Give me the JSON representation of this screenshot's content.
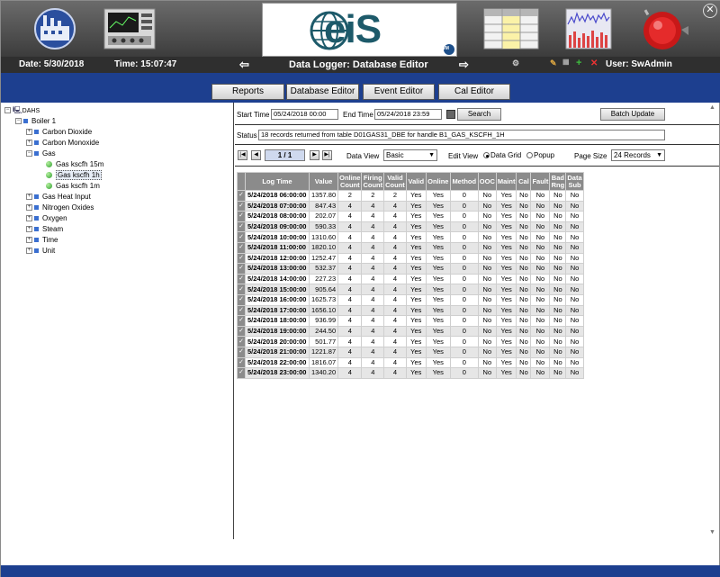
{
  "header": {
    "date_label": "Date: 5/30/2018",
    "time_label": "Time: 15:07:47",
    "title": "Data Logger: Database Editor",
    "user_label": "User: SwAdmin",
    "logo_text": "eiS",
    "logo_sub": "WM"
  },
  "nav": {
    "reports": "Reports",
    "database_editor": "Database Editor",
    "event_editor": "Event Editor",
    "cal_editor": "Cal Editor"
  },
  "tree": {
    "root": "DAHS",
    "boiler": "Boiler 1",
    "items": [
      "Carbon Dioxide",
      "Carbon Monoxide",
      "Gas",
      "Gas Heat Input",
      "Nitrogen Oxides",
      "Oxygen",
      "Steam",
      "Time",
      "Unit"
    ],
    "gas_children": [
      "Gas kscfh 15m",
      "Gas kscfh 1h",
      "Gas kscfh 1m"
    ]
  },
  "filters": {
    "start_time_label": "Start Time",
    "start_time_value": "05/24/2018 00:00",
    "end_time_label": "End Time",
    "end_time_value": "05/24/2018 23:59",
    "search_label": "Search",
    "batch_update_label": "Batch Update",
    "status_label": "Status",
    "status_value": "18 records returned from table D01GAS31_DBE for handle B1_GAS_KSCFH_1H"
  },
  "pager": {
    "page": "1 / 1",
    "data_view_label": "Data View",
    "data_view_value": "Basic",
    "edit_view_label": "Edit View",
    "edit_view_options": [
      "Data Grid",
      "Popup"
    ],
    "page_size_label": "Page Size",
    "page_size_value": "24 Records"
  },
  "grid": {
    "headers": [
      "Log Time",
      "Value",
      "Online Count",
      "Firing Count",
      "Valid Count",
      "Valid",
      "Online",
      "Method",
      "OOC",
      "Maint",
      "Cal",
      "Fault",
      "Bad Rng",
      "Data Sub"
    ],
    "rows": [
      [
        "5/24/2018 06:00:00",
        "1357.80",
        "2",
        "2",
        "2",
        "Yes",
        "Yes",
        "0",
        "No",
        "Yes",
        "No",
        "No",
        "No",
        "No"
      ],
      [
        "5/24/2018 07:00:00",
        "847.43",
        "4",
        "4",
        "4",
        "Yes",
        "Yes",
        "0",
        "No",
        "Yes",
        "No",
        "No",
        "No",
        "No"
      ],
      [
        "5/24/2018 08:00:00",
        "202.07",
        "4",
        "4",
        "4",
        "Yes",
        "Yes",
        "0",
        "No",
        "Yes",
        "No",
        "No",
        "No",
        "No"
      ],
      [
        "5/24/2018 09:00:00",
        "590.33",
        "4",
        "4",
        "4",
        "Yes",
        "Yes",
        "0",
        "No",
        "Yes",
        "No",
        "No",
        "No",
        "No"
      ],
      [
        "5/24/2018 10:00:00",
        "1310.60",
        "4",
        "4",
        "4",
        "Yes",
        "Yes",
        "0",
        "No",
        "Yes",
        "No",
        "No",
        "No",
        "No"
      ],
      [
        "5/24/2018 11:00:00",
        "1820.10",
        "4",
        "4",
        "4",
        "Yes",
        "Yes",
        "0",
        "No",
        "Yes",
        "No",
        "No",
        "No",
        "No"
      ],
      [
        "5/24/2018 12:00:00",
        "1252.47",
        "4",
        "4",
        "4",
        "Yes",
        "Yes",
        "0",
        "No",
        "Yes",
        "No",
        "No",
        "No",
        "No"
      ],
      [
        "5/24/2018 13:00:00",
        "532.37",
        "4",
        "4",
        "4",
        "Yes",
        "Yes",
        "0",
        "No",
        "Yes",
        "No",
        "No",
        "No",
        "No"
      ],
      [
        "5/24/2018 14:00:00",
        "227.23",
        "4",
        "4",
        "4",
        "Yes",
        "Yes",
        "0",
        "No",
        "Yes",
        "No",
        "No",
        "No",
        "No"
      ],
      [
        "5/24/2018 15:00:00",
        "905.64",
        "4",
        "4",
        "4",
        "Yes",
        "Yes",
        "0",
        "No",
        "Yes",
        "No",
        "No",
        "No",
        "No"
      ],
      [
        "5/24/2018 16:00:00",
        "1625.73",
        "4",
        "4",
        "4",
        "Yes",
        "Yes",
        "0",
        "No",
        "Yes",
        "No",
        "No",
        "No",
        "No"
      ],
      [
        "5/24/2018 17:00:00",
        "1656.10",
        "4",
        "4",
        "4",
        "Yes",
        "Yes",
        "0",
        "No",
        "Yes",
        "No",
        "No",
        "No",
        "No"
      ],
      [
        "5/24/2018 18:00:00",
        "936.99",
        "4",
        "4",
        "4",
        "Yes",
        "Yes",
        "0",
        "No",
        "Yes",
        "No",
        "No",
        "No",
        "No"
      ],
      [
        "5/24/2018 19:00:00",
        "244.50",
        "4",
        "4",
        "4",
        "Yes",
        "Yes",
        "0",
        "No",
        "Yes",
        "No",
        "No",
        "No",
        "No"
      ],
      [
        "5/24/2018 20:00:00",
        "501.77",
        "4",
        "4",
        "4",
        "Yes",
        "Yes",
        "0",
        "No",
        "Yes",
        "No",
        "No",
        "No",
        "No"
      ],
      [
        "5/24/2018 21:00:00",
        "1221.87",
        "4",
        "4",
        "4",
        "Yes",
        "Yes",
        "0",
        "No",
        "Yes",
        "No",
        "No",
        "No",
        "No"
      ],
      [
        "5/24/2018 22:00:00",
        "1816.07",
        "4",
        "4",
        "4",
        "Yes",
        "Yes",
        "0",
        "No",
        "Yes",
        "No",
        "No",
        "No",
        "No"
      ],
      [
        "5/24/2018 23:00:00",
        "1340.20",
        "4",
        "4",
        "4",
        "Yes",
        "Yes",
        "0",
        "No",
        "Yes",
        "No",
        "No",
        "No",
        "No"
      ]
    ]
  },
  "toolbar_icons": [
    "factory-icon",
    "control-panel-icon",
    "spreadsheet-icon",
    "trend-chart-icon",
    "alarm-bell-icon"
  ],
  "colors": {
    "nav_band": "#1d3f8f",
    "header_dark": "#3c3c3c",
    "grid_header": "#8b8b8b"
  }
}
